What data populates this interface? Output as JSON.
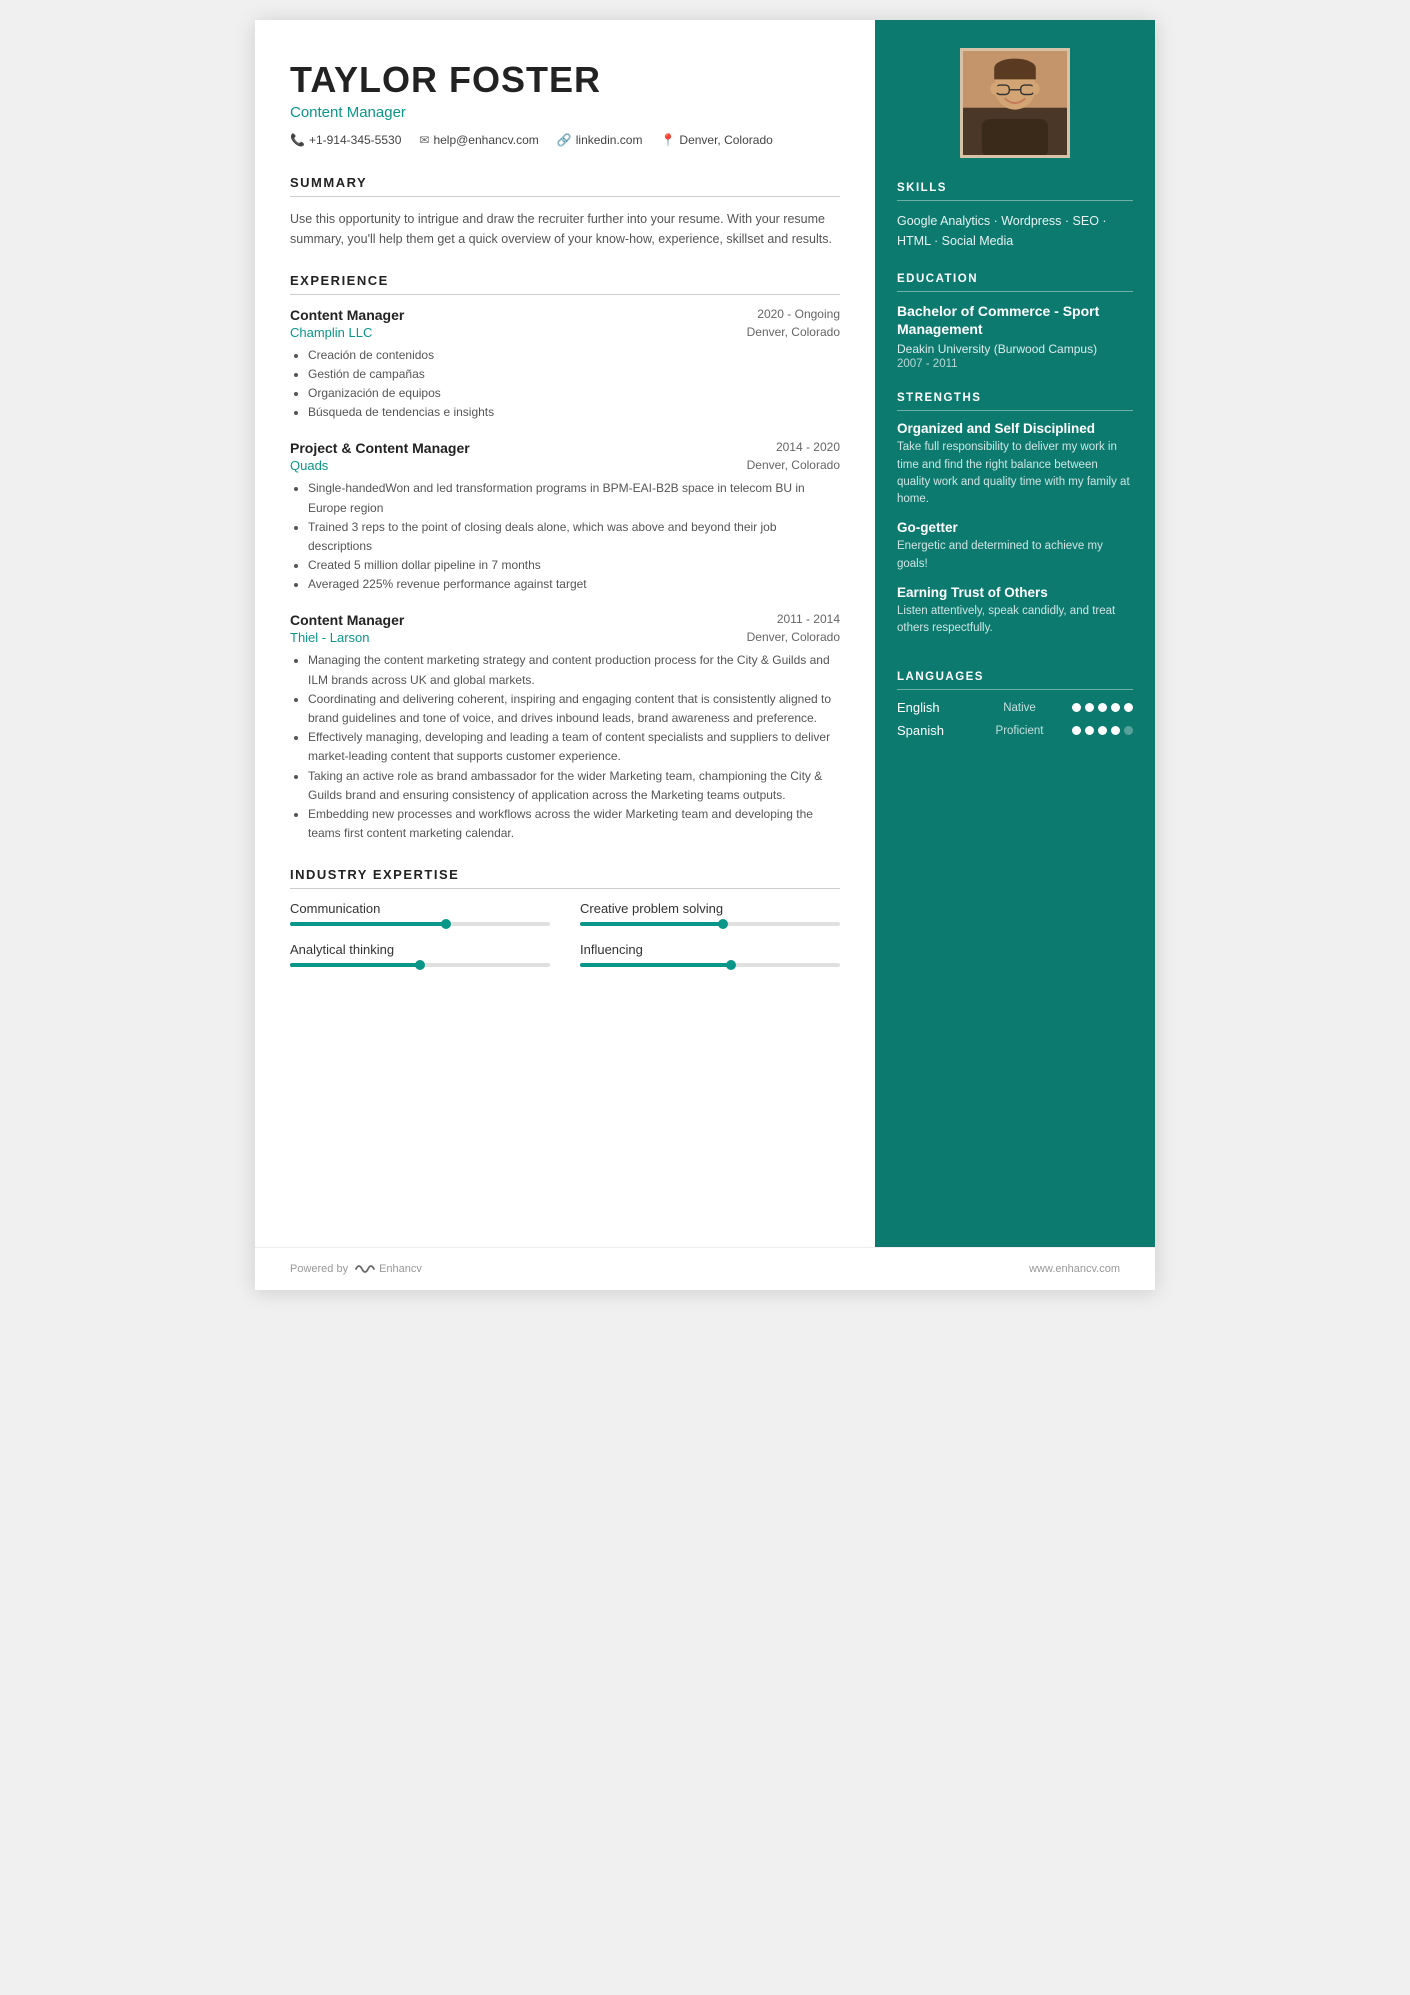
{
  "header": {
    "name": "TAYLOR FOSTER",
    "job_title": "Content Manager",
    "phone": "+1-914-345-5530",
    "email": "help@enhancv.com",
    "linkedin": "linkedin.com",
    "location": "Denver, Colorado"
  },
  "summary": {
    "title": "SUMMARY",
    "text": "Use this opportunity to intrigue and draw the recruiter further into your resume. With your resume summary, you'll help them get a quick overview of your know-how, experience, skillset and results."
  },
  "experience": {
    "title": "EXPERIENCE",
    "items": [
      {
        "title": "Content Manager",
        "company": "Champlin LLC",
        "dates": "2020 - Ongoing",
        "location": "Denver, Colorado",
        "bullets": [
          "Creación de contenidos",
          "Gestión de campañas",
          "Organización de equipos",
          "Búsqueda de tendencias e insights"
        ]
      },
      {
        "title": "Project & Content Manager",
        "company": "Quads",
        "dates": "2014 - 2020",
        "location": "Denver, Colorado",
        "bullets": [
          "Single-handedWon and led transformation programs in BPM-EAI-B2B space in telecom BU in Europe region",
          "Trained 3 reps to the point of closing deals alone, which was above and beyond their job descriptions",
          "Created 5 million dollar pipeline in 7 months",
          "Averaged 225% revenue performance against target"
        ]
      },
      {
        "title": "Content Manager",
        "company": "Thiel - Larson",
        "dates": "2011 - 2014",
        "location": "Denver, Colorado",
        "bullets": [
          "Managing the content marketing strategy and content production process for the City & Guilds and ILM brands across UK and global markets.",
          "Coordinating and delivering coherent, inspiring and engaging content that is consistently aligned to brand guidelines and tone of voice, and drives inbound leads, brand awareness and preference.",
          "Effectively managing, developing and leading a team of content specialists and suppliers to deliver market-leading content that supports customer experience.",
          "Taking an active role as brand ambassador for the wider Marketing team, championing the City & Guilds brand and ensuring consistency of application across the Marketing teams outputs.",
          "Embedding new processes and workflows across the wider Marketing team and developing the teams first content marketing calendar."
        ]
      }
    ]
  },
  "expertise": {
    "title": "INDUSTRY EXPERTISE",
    "items": [
      {
        "label": "Communication",
        "progress": 60
      },
      {
        "label": "Creative problem solving",
        "progress": 55
      },
      {
        "label": "Analytical thinking",
        "progress": 50
      },
      {
        "label": "Influencing",
        "progress": 58
      }
    ]
  },
  "skills": {
    "title": "SKILLS",
    "text": "Google Analytics · Wordpress · SEO · HTML · Social Media"
  },
  "education": {
    "title": "EDUCATION",
    "degree": "Bachelor of Commerce - Sport Management",
    "school": "Deakin University (Burwood Campus)",
    "years": "2007 - 2011"
  },
  "strengths": {
    "title": "STRENGTHS",
    "items": [
      {
        "name": "Organized and Self Disciplined",
        "desc": "Take full responsibility to deliver my work in time and find the right balance between quality work and quality time with my family at home."
      },
      {
        "name": "Go-getter",
        "desc": "Energetic and determined to achieve my goals!"
      },
      {
        "name": "Earning Trust of Others",
        "desc": "Listen attentively, speak candidly, and treat others respectfully."
      }
    ]
  },
  "languages": {
    "title": "LANGUAGES",
    "items": [
      {
        "name": "English",
        "level": "Native",
        "filled": 5,
        "total": 5
      },
      {
        "name": "Spanish",
        "level": "Proficient",
        "filled": 4,
        "total": 5
      }
    ]
  },
  "footer": {
    "powered_by": "Powered by",
    "brand": "Enhancv",
    "website": "www.enhancv.com"
  }
}
